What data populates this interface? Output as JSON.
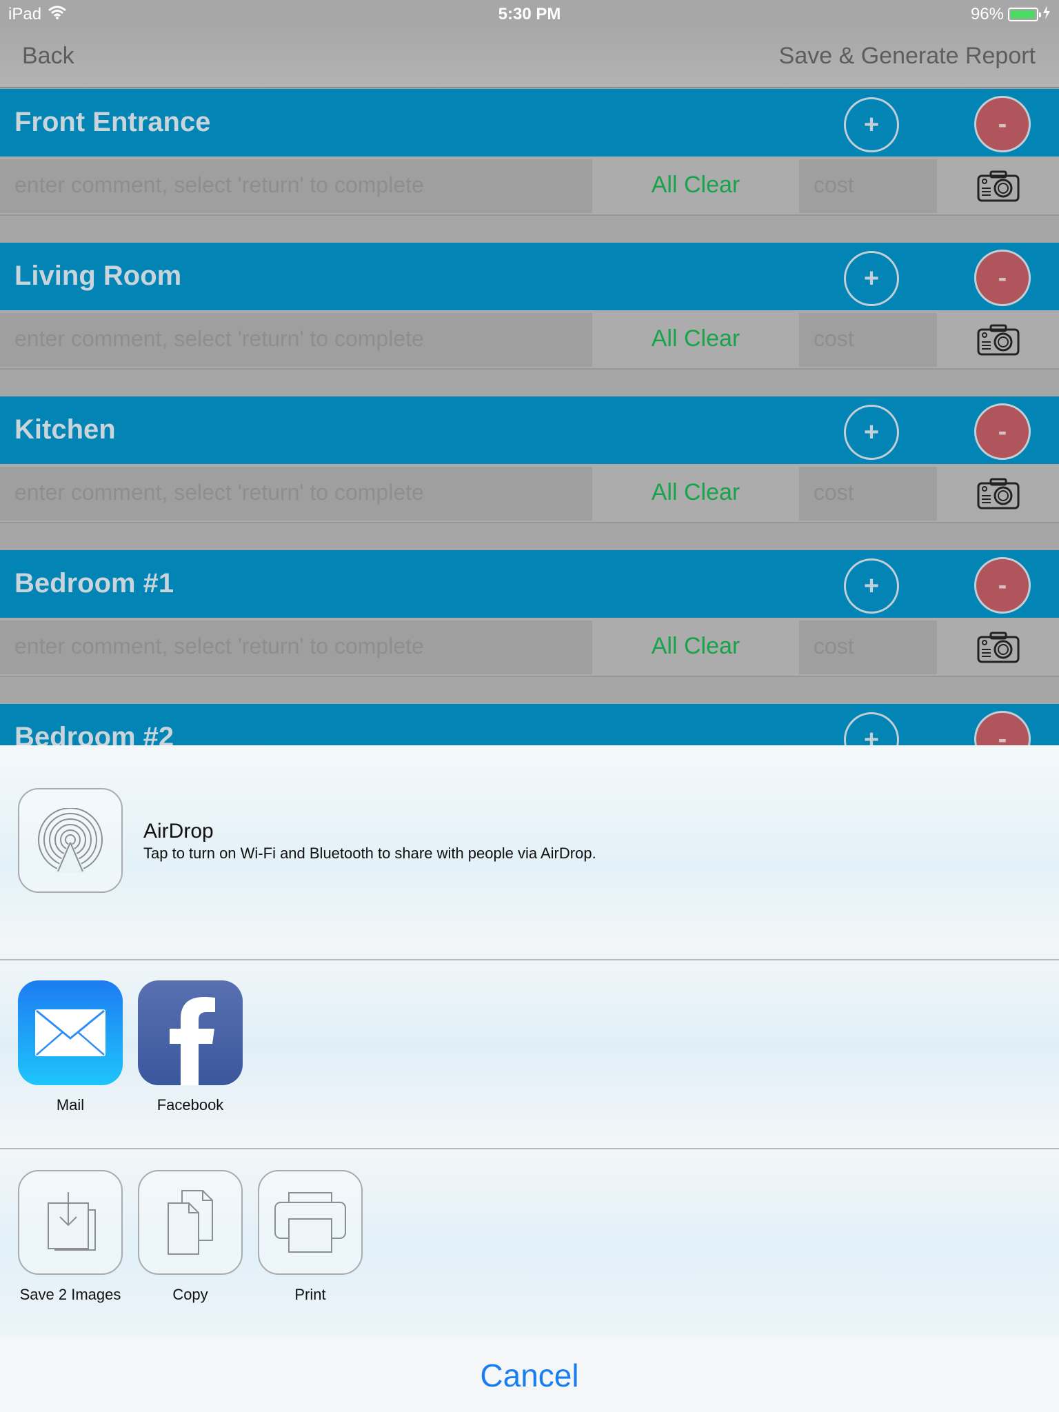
{
  "status_bar": {
    "device": "iPad",
    "time": "5:30 PM",
    "battery": "96%",
    "battery_level": 0.96,
    "icons": [
      "wifi-icon",
      "battery-icon",
      "charging-bolt-icon"
    ]
  },
  "nav": {
    "back_label": "Back",
    "save_label": "Save & Generate Report"
  },
  "row_defaults": {
    "comment_placeholder": "enter comment, select 'return' to complete",
    "status_label": "All Clear",
    "cost_placeholder": "cost",
    "plus_label": "+",
    "minus_label": "-"
  },
  "sections": [
    {
      "title": "Front Entrance"
    },
    {
      "title": "Living Room"
    },
    {
      "title": "Kitchen"
    },
    {
      "title": "Bedroom #1"
    },
    {
      "title": "Bedroom #2"
    }
  ],
  "share_sheet": {
    "airdrop": {
      "title": "AirDrop",
      "description": "Tap to turn on Wi-Fi and Bluetooth to share with people via AirDrop."
    },
    "apps": [
      {
        "label": "Mail",
        "icon": "mail-icon"
      },
      {
        "label": "Facebook",
        "icon": "facebook-icon"
      }
    ],
    "actions": [
      {
        "label": "Save 2 Images",
        "icon": "save-images-icon"
      },
      {
        "label": "Copy",
        "icon": "copy-icon"
      },
      {
        "label": "Print",
        "icon": "print-icon"
      }
    ],
    "cancel_label": "Cancel"
  },
  "colors": {
    "section_header": "#0284b5",
    "all_clear": "#17a34a",
    "minus_button": "#b1555c",
    "cancel": "#1a7ef0"
  }
}
